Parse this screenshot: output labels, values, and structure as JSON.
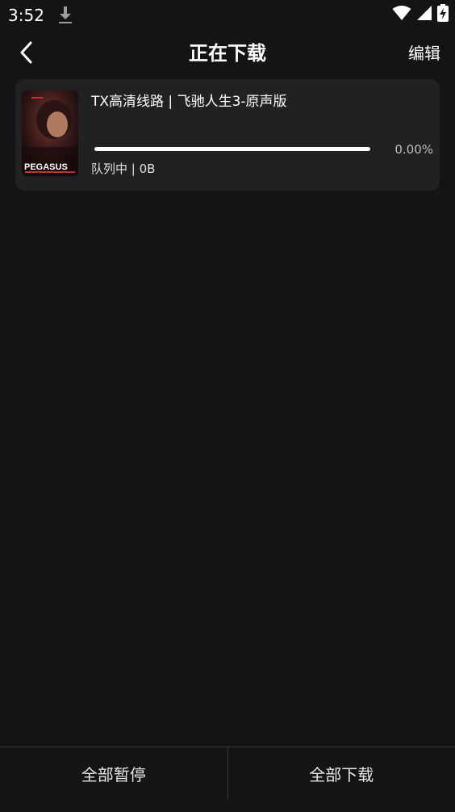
{
  "status_bar": {
    "time": "3:52",
    "icons": [
      "download-icon",
      "wifi-icon",
      "signal-icon",
      "battery-charging-icon"
    ]
  },
  "header": {
    "title": "正在下载",
    "edit_label": "编辑",
    "back_icon": "chevron-left-icon"
  },
  "downloads": [
    {
      "title": "TX高清线路 | 飞驰人生3-原声版",
      "progress_text": "0.00%",
      "progress": 0,
      "status": "队列中 | 0B",
      "poster_text": "PEGASUS"
    }
  ],
  "bottom": {
    "pause_all": "全部暂停",
    "download_all": "全部下载"
  },
  "colors": {
    "background": "#141414",
    "card": "#212121",
    "progress_track": "#ffffff",
    "text_secondary": "#bdbdbd"
  }
}
